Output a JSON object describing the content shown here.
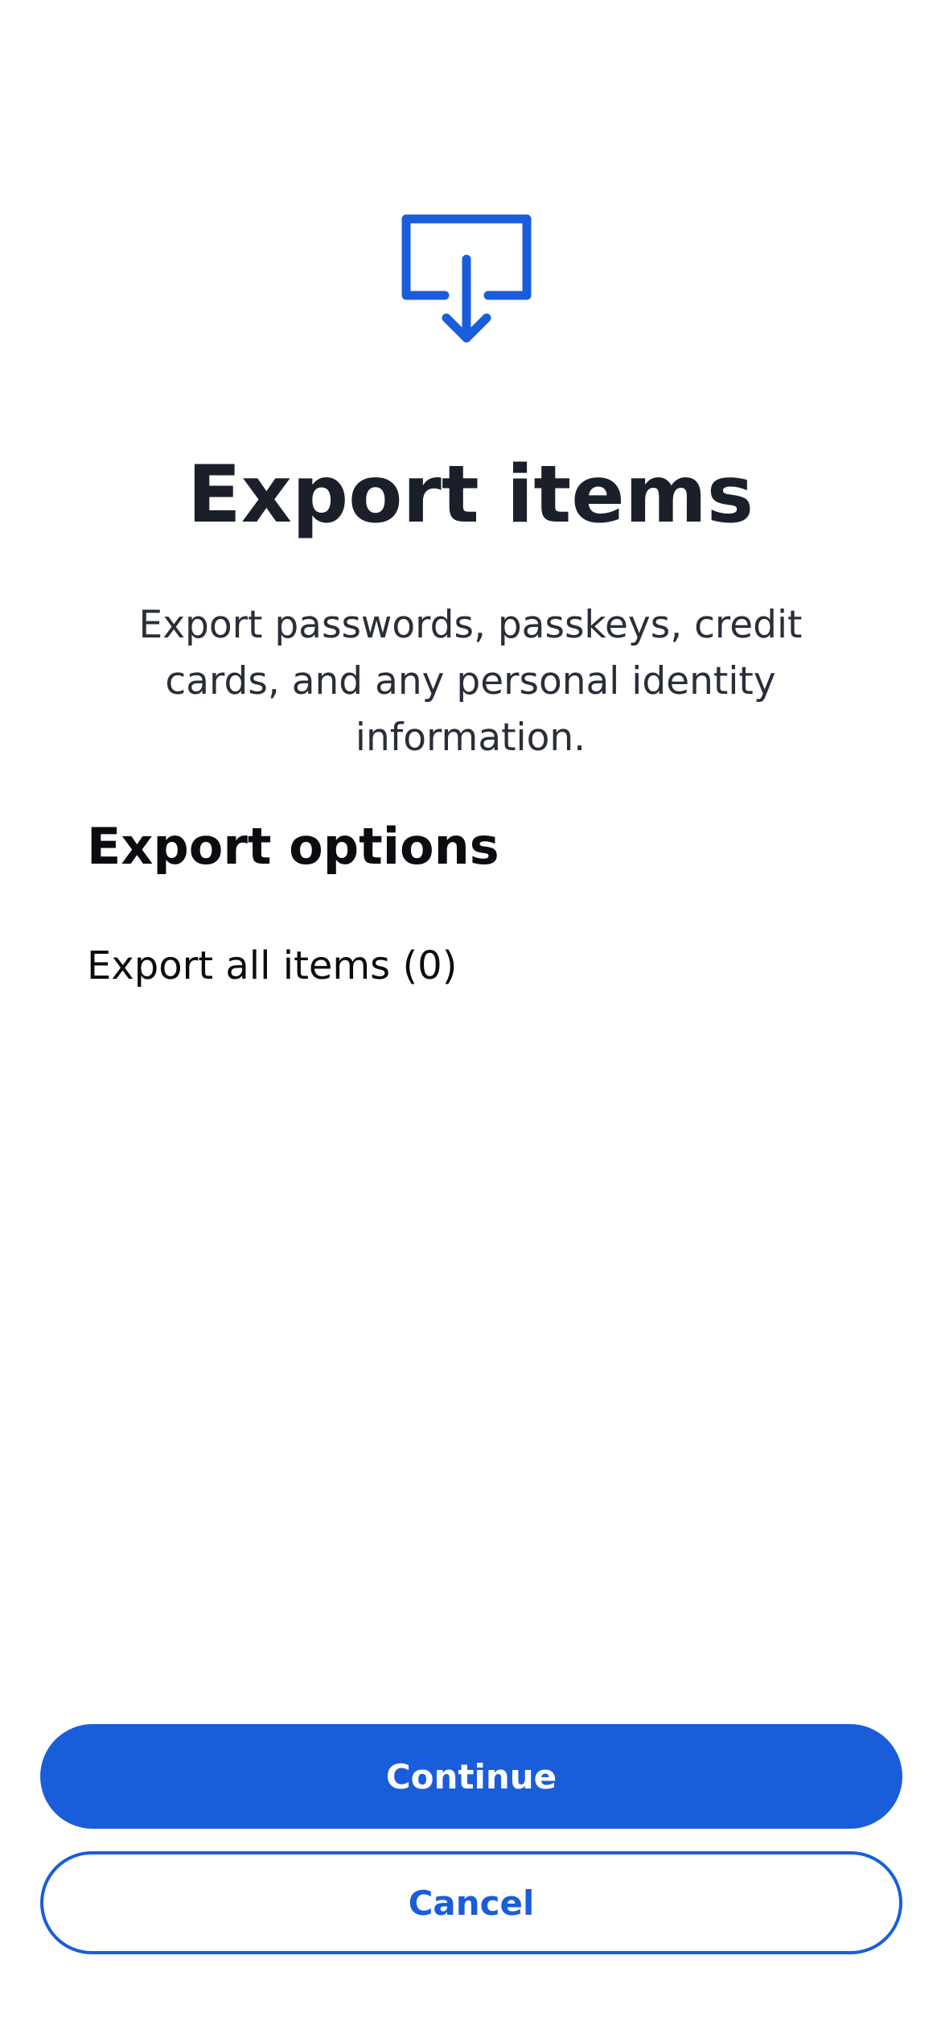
{
  "colors": {
    "accent": "#1a5ddb",
    "text_primary": "#1b1f2a",
    "background": "#ffffff"
  },
  "header": {
    "icon": "export-tray-icon",
    "title": "Export items",
    "description": "Export passwords, passkeys, credit cards, and any personal identity information."
  },
  "options": {
    "heading": "Export options",
    "items": [
      {
        "label": "Export all items (0)"
      }
    ]
  },
  "actions": {
    "continue_label": "Continue",
    "cancel_label": "Cancel"
  }
}
